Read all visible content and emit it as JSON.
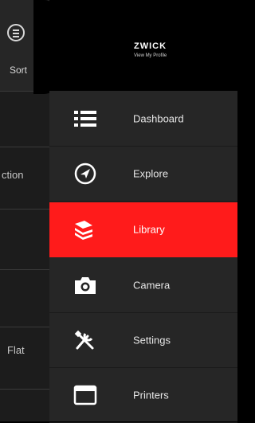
{
  "background_screen": {
    "sort_label": "Sort",
    "row_label_1": "ction",
    "row_label_2": "Flat"
  },
  "profile": {
    "name": "ZWICK",
    "link": "View My Profile"
  },
  "menu": {
    "items": [
      {
        "label": "Dashboard",
        "icon": "list-icon",
        "active": false
      },
      {
        "label": "Explore",
        "icon": "compass-icon",
        "active": false
      },
      {
        "label": "Library",
        "icon": "library-icon",
        "active": true
      },
      {
        "label": "Camera",
        "icon": "camera-icon",
        "active": false
      },
      {
        "label": "Settings",
        "icon": "tools-icon",
        "active": false
      },
      {
        "label": "Printers",
        "icon": "printer-window-icon",
        "active": false
      }
    ]
  },
  "colors": {
    "accent": "#ff1b1b",
    "drawer_background": "#262626",
    "profile_background": "#000000"
  }
}
